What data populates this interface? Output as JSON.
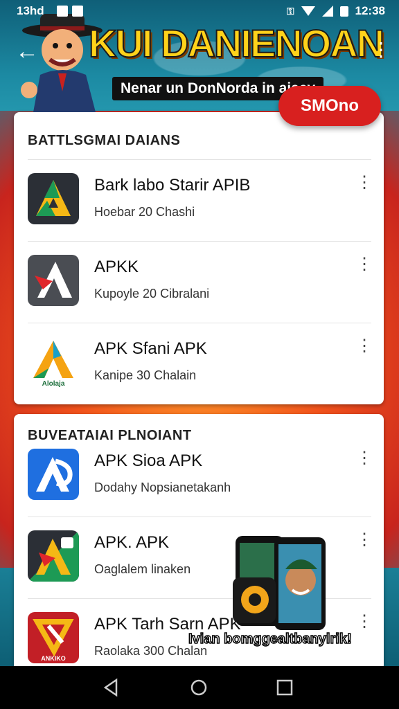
{
  "status_bar": {
    "time": "13hd",
    "clock": "12:38"
  },
  "header": {
    "title": "KUI DANIENOAN",
    "subtitle": "Nenar un DonNorda in aiaey",
    "badge": "SMOno"
  },
  "colors": {
    "accent": "#d8201f",
    "title": "#ffd21a",
    "background": "#1d7f97"
  },
  "sections": [
    {
      "title": "BATTLSGMAI DAIANS",
      "apps": [
        {
          "name": "Bark labo Starir APIB",
          "subtitle": "Hoebar 20 Chashi",
          "icon": "triangle-app-icon"
        },
        {
          "name": "APKK",
          "subtitle": "Kupoyle 20 Cibralani",
          "icon": "a-logo-app-icon"
        },
        {
          "name": "APK Sfani APK",
          "subtitle": "Kanipe 30 Chalain",
          "icon": "triangle-app-icon"
        }
      ]
    },
    {
      "title": "BUVEATAIAI PLNOIANT",
      "apps": [
        {
          "name": "APK Sioa APK",
          "subtitle": "Dodahy Nopsianetakanh",
          "icon": "a-logo-app-icon"
        },
        {
          "name": "APK. APK",
          "subtitle": "Oaglalem linaken",
          "icon": "a-logo-app-icon"
        },
        {
          "name": "APK Tarh Sarn APK",
          "subtitle": "Raolaka 300 Chalan",
          "icon": "a-logo-app-icon"
        }
      ]
    }
  ],
  "promo": {
    "text": "Ivian bomggealtbanylrik!"
  },
  "icon_labels": {
    "app3_label": "Alolaja",
    "app6_label": "ANKIKO"
  }
}
